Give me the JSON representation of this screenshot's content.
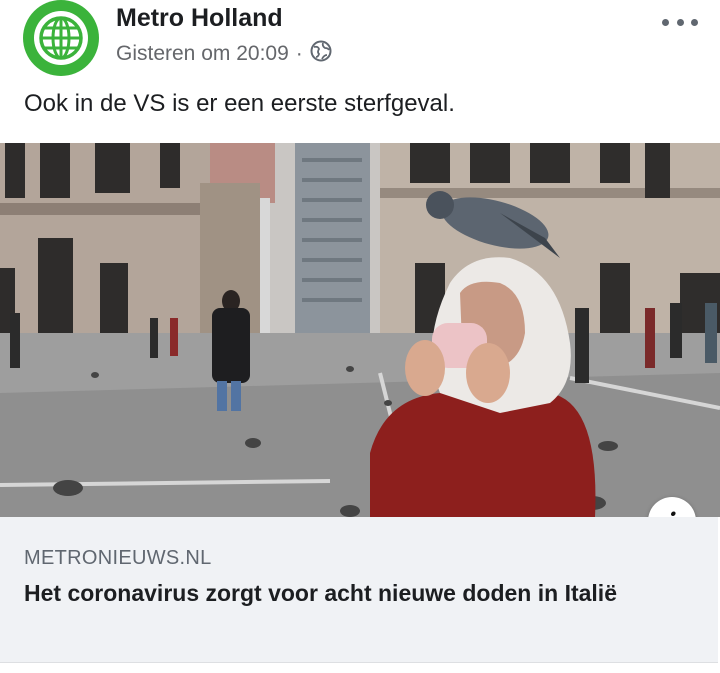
{
  "post": {
    "page_name": "Metro Holland",
    "timestamp": "Gisteren om 20:09",
    "separator": "·",
    "privacy_icon": "globe-icon",
    "more_icon": "more-options-icon",
    "text": "Ook in de VS is er een eerste sterfgeval."
  },
  "link_preview": {
    "image_icon": "photo",
    "info_icon": "info-icon",
    "info_label": "i",
    "domain": "METRONIEUWS.NL",
    "title": "Het coronavirus zorgt voor acht nieuwe doden in Italië"
  },
  "colors": {
    "brand_green": "#3bb33b",
    "card_background": "#f0f2f5",
    "secondary_text": "#65676b"
  }
}
